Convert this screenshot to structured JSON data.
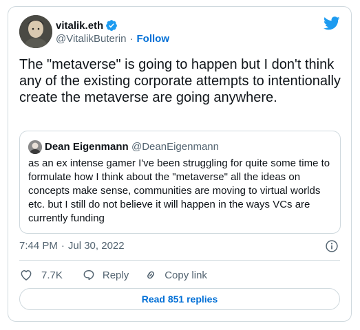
{
  "author": {
    "name": "vitalik.eth",
    "handle": "@VitalikButerin",
    "follow_label": "Follow",
    "separator": "·"
  },
  "tweet": {
    "text": "The \"metaverse\" is going to happen but I don't think any of the existing corporate attempts to intentionally create the metaverse are going anywhere.",
    "time": "7:44 PM",
    "separator": "·",
    "date": "Jul 30, 2022"
  },
  "quoted": {
    "name": "Dean Eigenmann",
    "handle": "@DeanEigenmann",
    "text": "as an ex intense gamer I've been struggling for quite some time to formulate how I think about the \"metaverse\" all the ideas on concepts make sense, communities are moving to virtual worlds etc. but I still do not believe it will happen in the ways VCs are currently funding"
  },
  "actions": {
    "like_count": "7.7K",
    "reply_label": "Reply",
    "copy_label": "Copy link",
    "read_replies_label": "Read 851 replies"
  },
  "colors": {
    "accent": "#1d9bf0",
    "link": "#006fd6",
    "muted": "#536471",
    "text": "#0f1419",
    "border": "#cfd9de"
  },
  "icons": [
    "twitter-bird-icon",
    "verified-badge-icon",
    "info-icon",
    "heart-icon",
    "reply-bubble-icon",
    "link-icon"
  ]
}
